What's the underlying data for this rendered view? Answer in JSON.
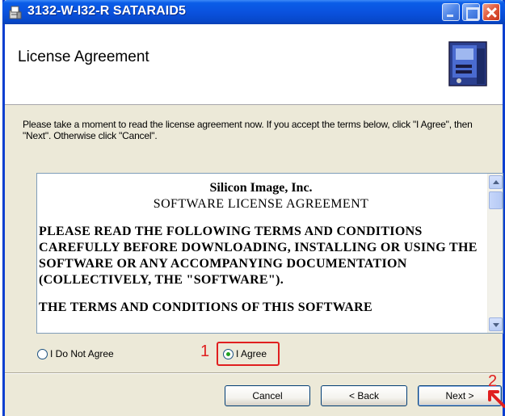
{
  "window": {
    "title": "3132-W-I32-R SATARAID5",
    "title_icon": "installer-icon"
  },
  "header": {
    "title": "License Agreement",
    "graphic": "computer-install-graphic"
  },
  "instructions": "Please take a moment to read the license agreement now. If you accept the terms below, click \"I Agree\", then \"Next\". Otherwise click \"Cancel\".",
  "license": {
    "heading_1": "Silicon Image, Inc.",
    "heading_2": "SOFTWARE LICENSE AGREEMENT",
    "paragraph_1": "PLEASE READ THE FOLLOWING TERMS AND CONDITIONS CAREFULLY BEFORE DOWNLOADING, INSTALLING OR USING THE SOFTWARE OR ANY ACCOMPANYING DOCUMENTATION (COLLECTIVELY, THE \"SOFTWARE\").",
    "paragraph_2": "THE TERMS AND CONDITIONS OF THIS SOFTWARE"
  },
  "options": {
    "disagree_label": "I Do Not Agree",
    "agree_label": "I Agree",
    "selected": "agree"
  },
  "annotations": {
    "step_1": "1",
    "step_2": "2",
    "color": "#e01f1f"
  },
  "buttons": {
    "cancel": "Cancel",
    "back": "< Back",
    "next": "Next >"
  }
}
